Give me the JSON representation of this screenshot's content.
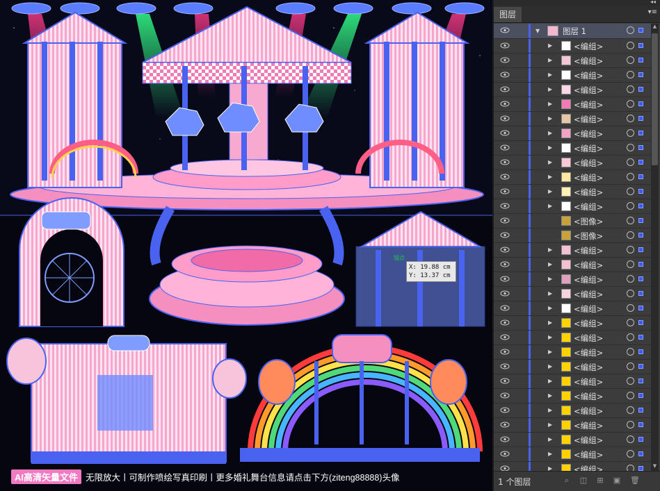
{
  "canvas": {
    "coord_readout": {
      "x": "X: 19.88 cm",
      "y": "Y: 13.37 cm"
    },
    "anchor_label": "锚点",
    "banner": {
      "badge": "AI高清矢量文件",
      "text": "无限放大丨可制作喷绘写真印刷丨更多婚礼舞台信息请点击下方(ziteng88888)头像"
    }
  },
  "layers_panel": {
    "tab_label": "图层",
    "top_layer": {
      "name": "图层 1"
    },
    "rows": [
      {
        "name": "<编组>",
        "thumb": "#ffffff"
      },
      {
        "name": "<编组>",
        "thumb": "#f4c7d8"
      },
      {
        "name": "<编组>",
        "thumb": "#ffffff"
      },
      {
        "name": "<编组>",
        "thumb": "#fbd6e6"
      },
      {
        "name": "<编组>",
        "thumb": "#f07bb6"
      },
      {
        "name": "<编组>",
        "thumb": "#e6c7a6"
      },
      {
        "name": "<编组>",
        "thumb": "#f3a3c6"
      },
      {
        "name": "<编组>",
        "thumb": "#ffffff"
      },
      {
        "name": "<编组>",
        "thumb": "#f9c9d9"
      },
      {
        "name": "<编组>",
        "thumb": "#ffe7a0"
      },
      {
        "name": "<编组>",
        "thumb": "#fff1b6"
      },
      {
        "name": "<编组>",
        "thumb": "#ffffff"
      },
      {
        "name": "<图像>",
        "thumb": "#c9a23a"
      },
      {
        "name": "<图像>",
        "thumb": "#c9a23a"
      },
      {
        "name": "<编组>",
        "thumb": "#f3c1d3"
      },
      {
        "name": "<编组>",
        "thumb": "#f3c1d3"
      },
      {
        "name": "<编组>",
        "thumb": "#e0a0c0"
      },
      {
        "name": "<编组>",
        "thumb": "#f7d2e0"
      },
      {
        "name": "<编组>",
        "thumb": "#ffffff"
      },
      {
        "name": "<编组>",
        "thumb": "#ffd200"
      },
      {
        "name": "<编组>",
        "thumb": "#ffd200"
      },
      {
        "name": "<编组>",
        "thumb": "#ffd200"
      },
      {
        "name": "<编组>",
        "thumb": "#ffd200"
      },
      {
        "name": "<编组>",
        "thumb": "#ffd200"
      },
      {
        "name": "<编组>",
        "thumb": "#ffd200"
      },
      {
        "name": "<编组>",
        "thumb": "#ffd200"
      },
      {
        "name": "<编组>",
        "thumb": "#ffd200"
      },
      {
        "name": "<编组>",
        "thumb": "#ffd200"
      },
      {
        "name": "<编组>",
        "thumb": "#ffd200"
      },
      {
        "name": "<编组>",
        "thumb": "#ffd200"
      }
    ],
    "footer": {
      "count_label": "1 个图层"
    }
  },
  "colors": {
    "selection_blue": "#4a62f0",
    "pink": "#f48fc0",
    "light_pink": "#ffd3e8"
  }
}
